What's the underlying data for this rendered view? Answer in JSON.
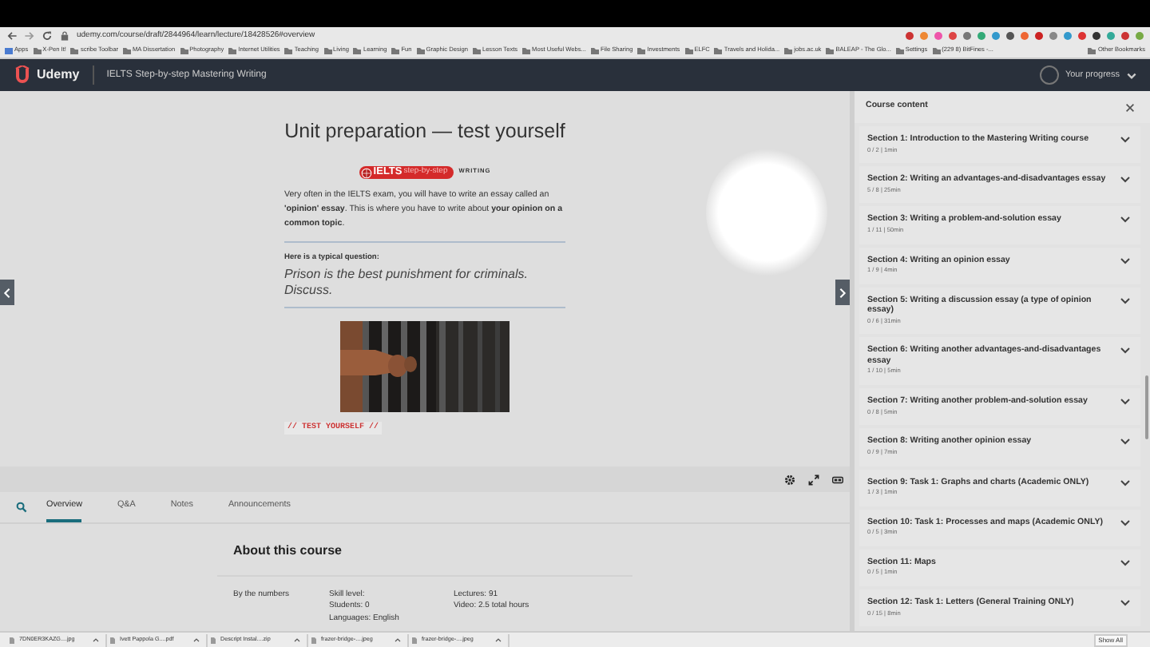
{
  "browser": {
    "url": "udemy.com/course/draft/2844964/learn/lecture/18428526#overview",
    "bookmarks": [
      "Apps",
      "X-Pen It!",
      "scribe Toolbar",
      "MA Dissertation",
      "Photography",
      "Internet Utilities",
      "Teaching",
      "Living",
      "Learning",
      "Fun",
      "Graphic Design",
      "Lesson Texts",
      "Most Useful Webs...",
      "File Sharing",
      "Investments",
      "ELFC",
      "Travels and Holida...",
      "jobs.ac.uk",
      "BALEAP - The Glo...",
      "Settings",
      "(229 8) BitFines -..."
    ],
    "other_bookmarks": "Other Bookmarks"
  },
  "header": {
    "brand": "Udemy",
    "course_title": "IELTS Step-by-step Mastering Writing",
    "progress_label": "Your progress"
  },
  "lecture": {
    "title": "Unit preparation — test yourself",
    "logo": {
      "name": "IELTS",
      "tagline": "step-by-step",
      "suffix": "WRITING"
    },
    "intro": "Very often in the IELTS exam, you will have to write an essay called an **'opinion' essay**. This is where you have to write about **your opinion on a common topic**.",
    "question_label": "Here is a typical question:",
    "question": "Prison is the best punishment for criminals. Discuss.",
    "section_heading": "// TEST YOURSELF //"
  },
  "tabs": [
    {
      "label": "Overview",
      "selected": true
    },
    {
      "label": "Q&A",
      "selected": false
    },
    {
      "label": "Notes",
      "selected": false
    },
    {
      "label": "Announcements",
      "selected": false
    }
  ],
  "about": {
    "heading": "About this course",
    "numbers_label": "By the numbers",
    "column_1": [
      "Skill level:",
      "Students: 0",
      "Languages: English"
    ],
    "column_2": [
      "Lectures: 91",
      "Video: 2.5 total hours"
    ]
  },
  "sidebar": {
    "title": "Course content",
    "sections": [
      {
        "title": "Section 1: Introduction to the Mastering Writing course",
        "meta": "0 / 2 | 1min",
        "expanded": false
      },
      {
        "title": "Section 2: Writing an advantages-and-disadvantages essay",
        "meta": "5 / 8 | 25min",
        "expanded": false
      },
      {
        "title": "Section 3: Writing a problem-and-solution essay",
        "meta": "1 / 11 | 50min",
        "expanded": false
      },
      {
        "title": "Section 4: Writing an opinion essay",
        "meta": "1 / 9 | 4min",
        "expanded": false
      },
      {
        "title": "Section 5: Writing a discussion essay (a type of opinion essay)",
        "meta": "0 / 6 | 31min",
        "expanded": false
      },
      {
        "title": "Section 6: Writing another advantages-and-disadvantages essay",
        "meta": "1 / 10 | 5min",
        "expanded": false
      },
      {
        "title": "Section 7: Writing another problem-and-solution essay",
        "meta": "0 / 8 | 5min",
        "expanded": false
      },
      {
        "title": "Section 8: Writing another opinion essay",
        "meta": "0 / 9 | 7min",
        "expanded": false
      },
      {
        "title": "Section 9: Task 1: Graphs and charts (Academic ONLY)",
        "meta": "1 / 3 | 1min",
        "expanded": false
      },
      {
        "title": "Section 10: Task 1: Processes and maps (Academic ONLY)",
        "meta": "0 / 5 | 3min",
        "expanded": false
      },
      {
        "title": "Section 11: Maps",
        "meta": "0 / 5 | 1min",
        "expanded": false
      },
      {
        "title": "Section 12: Task 1: Letters (General Training ONLY)",
        "meta": "0 / 15 | 8min",
        "expanded": false
      }
    ]
  },
  "downloads": {
    "files": [
      "7DN0ER3KAZG....jpg",
      "Ivett Pappola G....pdf",
      "Descript Instal....zip",
      "frazer-bridge-....jpeg",
      "frazer-bridge-....jpeg"
    ],
    "show_all": "Show All"
  }
}
